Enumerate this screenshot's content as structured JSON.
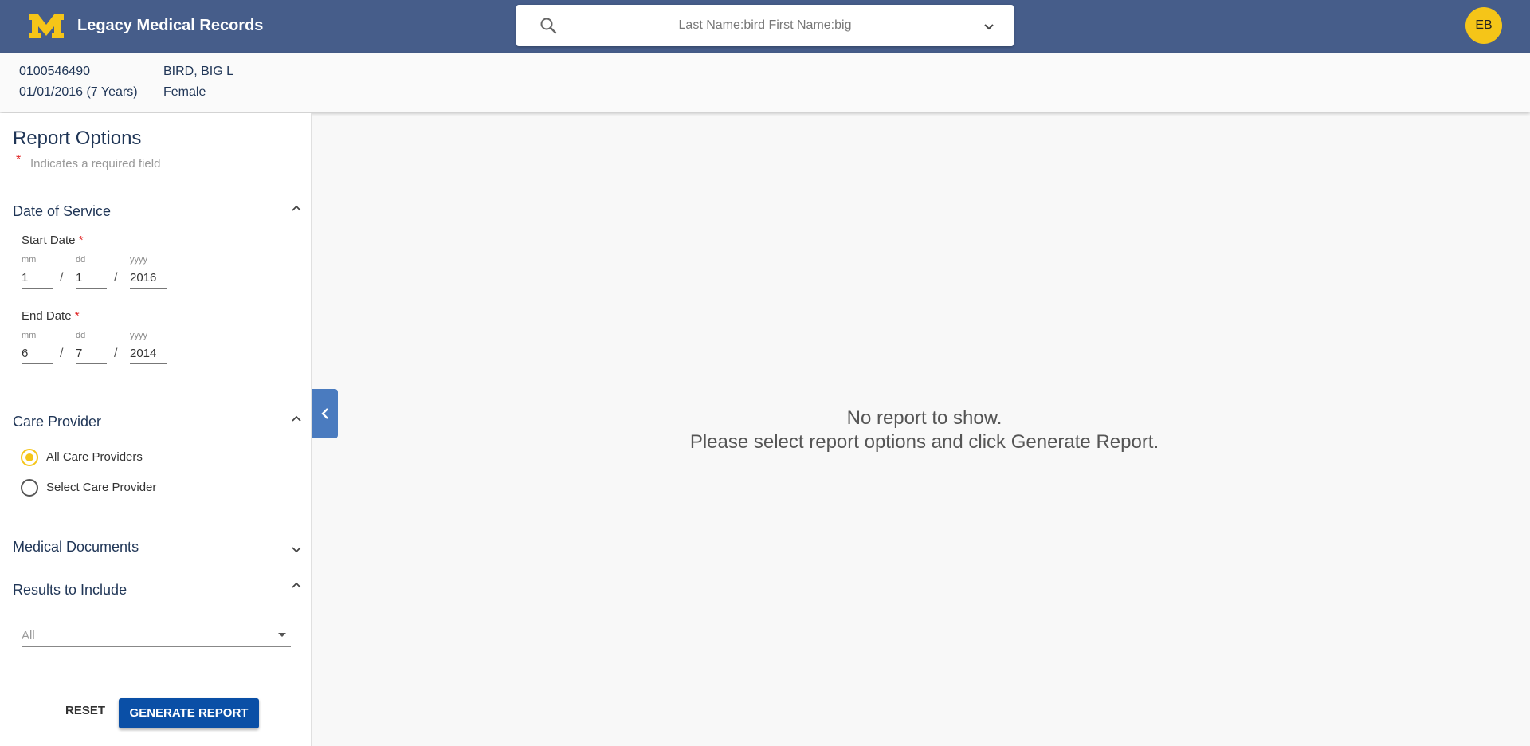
{
  "header": {
    "app_title": "Legacy Medical Records",
    "logo_icon": "block-m-logo-icon",
    "search_text": "Last Name:bird First Name:big",
    "avatar_initials": "EB",
    "colors": {
      "header_bg": "#465d8a",
      "accent": "#f5c518"
    }
  },
  "patient": {
    "mrn": "0100546490",
    "name": "BIRD, BIG L",
    "dob_age": "01/01/2016 (7 Years)",
    "sex": "Female"
  },
  "sidebar": {
    "title": "Report Options",
    "required_star": "*",
    "required_note": "Indicates a required field",
    "date_of_service": {
      "title": "Date of Service",
      "expanded": true,
      "start": {
        "label": "Start Date",
        "star": "*",
        "mm_label": "mm",
        "dd_label": "dd",
        "yyyy_label": "yyyy",
        "mm": "1",
        "dd": "1",
        "yyyy": "2016"
      },
      "end": {
        "label": "End Date",
        "star": "*",
        "mm_label": "mm",
        "dd_label": "dd",
        "yyyy_label": "yyyy",
        "mm": "6",
        "dd": "7",
        "yyyy": "2014"
      },
      "separator": "/"
    },
    "care_provider": {
      "title": "Care Provider",
      "expanded": true,
      "options": [
        {
          "label": "All Care Providers",
          "selected": true
        },
        {
          "label": "Select Care Provider",
          "selected": false
        }
      ]
    },
    "medical_documents": {
      "title": "Medical Documents",
      "expanded": false
    },
    "results_to_include": {
      "title": "Results to Include",
      "expanded": true,
      "selected_value": "All"
    },
    "reset_label": "RESET",
    "generate_label": "GENERATE REPORT"
  },
  "main": {
    "empty_line1": "No report to show.",
    "empty_line2": "Please select report options and click Generate Report."
  }
}
